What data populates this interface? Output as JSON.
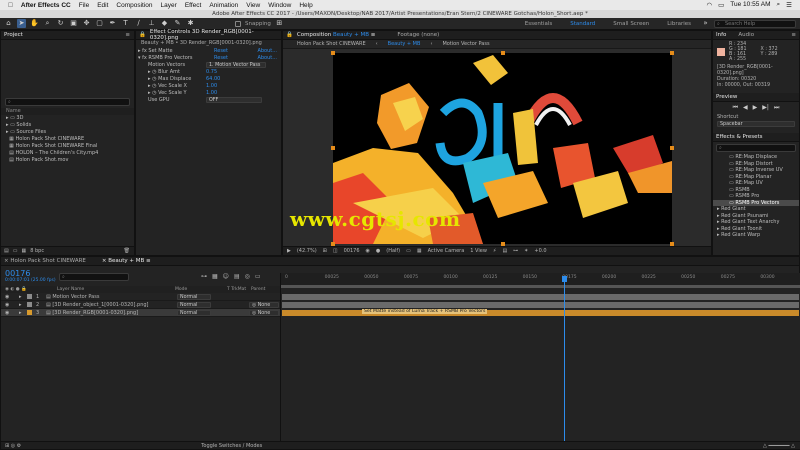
{
  "menubar": {
    "apple": "",
    "app_name": "After Effects CC",
    "items": [
      "File",
      "Edit",
      "Composition",
      "Layer",
      "Effect",
      "Animation",
      "View",
      "Window",
      "Help"
    ],
    "clock": "Tue 10:55 AM"
  },
  "titlebar": {
    "text": "Adobe After Effects CC 2017 - /Users/MAXON/Desktop/NAB 2017/Artist Presentations/Eran Stern/2 CINEWARE Gotchas/Holon_Short.aep *"
  },
  "toolbar": {
    "snapping": "Snapping",
    "workspaces": [
      "Essentials",
      "Standard",
      "Small Screen",
      "Libraries"
    ],
    "search_placeholder": "Search Help"
  },
  "project": {
    "tab": "Project",
    "search_placeholder": "",
    "col_name": "Name",
    "items": [
      "3D",
      "Solids",
      "Source Files",
      "Holon Pack Shot CINEWARE",
      "Holon Pack Shot CINEWARE Final",
      "HOLON – The Children's City.mp4",
      "Holon Pack Shot.mov"
    ],
    "bpc": "8 bpc"
  },
  "effect_controls": {
    "tab": "Effect Controls 3D Render_RGB[0001-0320].png",
    "subtitle": "Beauty + MB • 3D Render_RGB[0001-0320].png",
    "effects": [
      {
        "name": "Set Matte",
        "reset": "Reset",
        "about": "About..."
      },
      {
        "name": "RSMB Pro Vectors",
        "reset": "Reset",
        "about": "About..."
      }
    ],
    "props": [
      {
        "label": "Motion Vectors",
        "value": "1. Motion Vector Pass",
        "type": "dropdown"
      },
      {
        "label": "Blur Amt",
        "value": "0.75",
        "type": "number"
      },
      {
        "label": "Max Displace",
        "value": "64.00",
        "type": "number"
      },
      {
        "label": "Vec Scale X",
        "value": "1.00",
        "type": "number"
      },
      {
        "label": "Vec Scale Y",
        "value": "1.00",
        "type": "number"
      },
      {
        "label": "Use GPU",
        "value": "OFF",
        "type": "dropdown"
      }
    ]
  },
  "composition": {
    "tab": "Composition",
    "tab_name": "Beauty + MB",
    "footage_tab": "Footage (none)",
    "breadcrumbs": [
      "Holon Pack Shot CINEWARE",
      "Beauty + MB",
      "Motion Vector Pass"
    ],
    "footer": {
      "zoom": "(42.7%)",
      "timecode": "00176",
      "resolution": "(Half)",
      "camera": "Active Camera",
      "views": "1 View",
      "exposure": "+0.0"
    }
  },
  "info": {
    "tabs": [
      "Info",
      "Audio"
    ],
    "r": "R : 234",
    "g": "G : 181",
    "b": "B : 161",
    "a": "A : 255",
    "x": "X : 372",
    "y": "Y : 289",
    "swatch": "#f0b39f",
    "file": "[3D Render_RGB[0001-0320].png]",
    "duration": "Duration: 00320",
    "in_out": "In: 00000, Out: 00319"
  },
  "preview": {
    "title": "Preview"
  },
  "shortcut": {
    "title": "Shortcut",
    "value": "Spacebar"
  },
  "effects_presets": {
    "title": "Effects & Presets",
    "search_placeholder": "",
    "items": [
      "RE:Map Displace",
      "RE:Map Distort",
      "RE:Map Inverse UV",
      "RE:Map Planar",
      "RE:Map UV",
      "RSMB",
      "RSMB Pro",
      "RSMB Pro Vectors"
    ],
    "selected_index": 7,
    "groups": [
      "Red Giant",
      "Red Giant Psunami",
      "Red Giant Text Anarchy",
      "Red Giant Toonit",
      "Red Giant Warp"
    ]
  },
  "timeline": {
    "tabs": [
      "Holon Pack Shot CINEWARE",
      "Beauty + MB"
    ],
    "timecode": "00176",
    "timecode_sub": "0:00:07:01 (25.00 fps)",
    "search_placeholder": "",
    "col_layer": "Layer Name",
    "col_mode": "Mode",
    "col_trkmat": "T  TrkMat",
    "col_parent": "Parent",
    "layers": [
      {
        "num": "1",
        "name": "Motion Vector Pass",
        "mode": "Normal",
        "parent": "",
        "color": "#8c8c8c"
      },
      {
        "num": "2",
        "name": "[3D Render_object_1[0001-0320].png]",
        "mode": "Normal",
        "parent": "None",
        "color": "#8c8c8c"
      },
      {
        "num": "3",
        "name": "[3D Render_RGB[0001-0320].png]",
        "mode": "Normal",
        "parent": "None",
        "color": "#d89a2d"
      }
    ],
    "ruler": [
      "0",
      "00025",
      "00050",
      "00075",
      "00100",
      "00125",
      "00150",
      "00175",
      "00200",
      "00225",
      "00250",
      "00275",
      "00300"
    ],
    "playhead_frame": 176,
    "total_frames": 320,
    "bar_label": "Set Matte instead of Luma Track + RSMB Pro Vectors",
    "toggle_label": "Toggle Switches / Modes"
  },
  "watermark": "www.cgtsj.com"
}
